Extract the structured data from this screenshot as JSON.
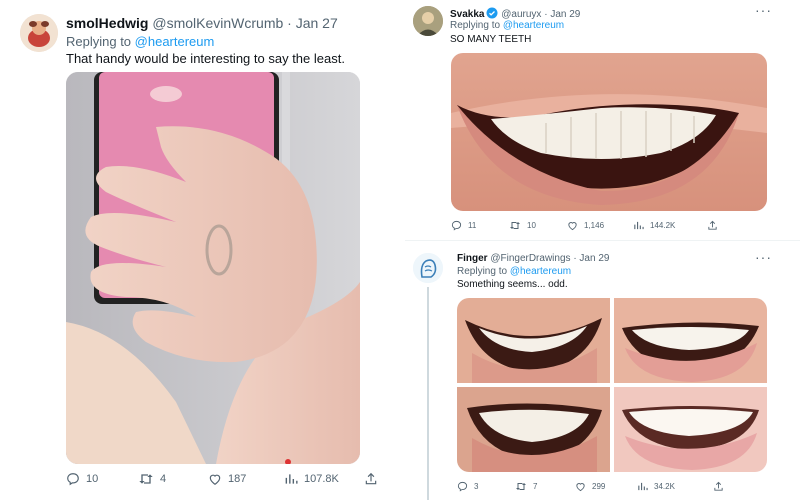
{
  "left_tweet": {
    "display_name": "smolHedwig",
    "handle": "@smolKevinWcrumb",
    "date": "· Jan 27",
    "replying_prefix": "Replying to",
    "replying_to": "@heartereum",
    "text": "That handy would be interesting to say the least.",
    "stats": {
      "replies": "10",
      "retweets": "4",
      "likes": "187",
      "views": "107.8K"
    }
  },
  "right_top_tweet": {
    "display_name": "Svakka",
    "handle": "@auruyx",
    "date": "· Jan 29",
    "replying_prefix": "Replying to",
    "replying_to": "@heartereum",
    "text": "SO MANY TEETH",
    "stats": {
      "replies": "11",
      "retweets": "10",
      "likes": "1,146",
      "views": "144.2K"
    }
  },
  "right_bottom_tweet": {
    "display_name": "Finger",
    "handle": "@FingerDrawings",
    "date": "· Jan 29",
    "replying_prefix": "Replying to",
    "replying_to": "@heartereum",
    "text": "Something seems... odd.",
    "stats": {
      "replies": "3",
      "retweets": "7",
      "likes": "299",
      "views": "34.2K"
    }
  },
  "icons": {
    "reply": "reply-icon",
    "retweet": "retweet-icon",
    "like": "heart-icon",
    "views": "views-icon",
    "share": "share-icon",
    "more": "more-icon",
    "verified": "verified-badge-icon"
  },
  "colors": {
    "link": "#1d9bf0",
    "secondary_text": "#536471",
    "pink_phone": "#e58ab0"
  }
}
